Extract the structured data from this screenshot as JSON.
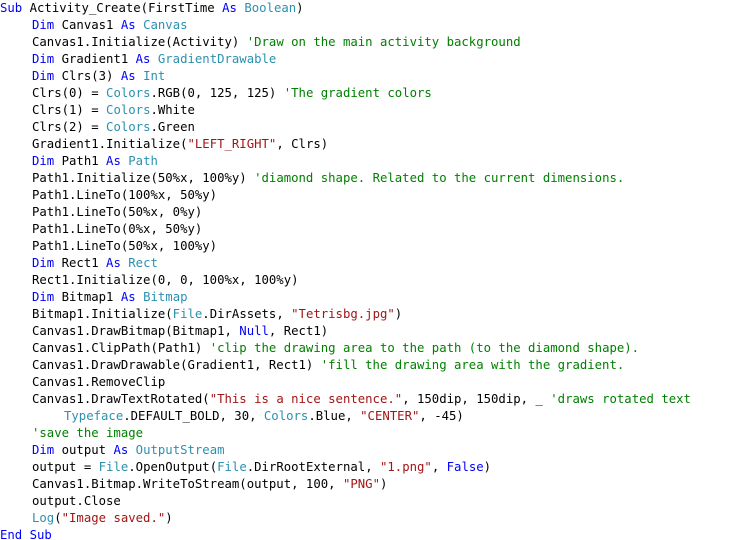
{
  "colors": {
    "keyword": "#0000ff",
    "type": "#2b91af",
    "string": "#a31515",
    "comment": "#008000",
    "plain": "#000000"
  },
  "code_lines": [
    {
      "indent": 0,
      "tokens": [
        [
          "kw",
          "Sub"
        ],
        [
          "pl",
          " Activity_Create(FirstTime "
        ],
        [
          "kw",
          "As"
        ],
        [
          "pl",
          " "
        ],
        [
          "ty",
          "Boolean"
        ],
        [
          "pl",
          ")"
        ]
      ]
    },
    {
      "indent": 1,
      "tokens": [
        [
          "kw",
          "Dim"
        ],
        [
          "pl",
          " Canvas1 "
        ],
        [
          "kw",
          "As"
        ],
        [
          "pl",
          " "
        ],
        [
          "ty",
          "Canvas"
        ]
      ]
    },
    {
      "indent": 1,
      "tokens": [
        [
          "pl",
          "Canvas1.Initialize(Activity) "
        ],
        [
          "cm",
          "'Draw on the main activity background"
        ]
      ]
    },
    {
      "indent": 1,
      "tokens": [
        [
          "kw",
          "Dim"
        ],
        [
          "pl",
          " Gradient1 "
        ],
        [
          "kw",
          "As"
        ],
        [
          "pl",
          " "
        ],
        [
          "ty",
          "GradientDrawable"
        ]
      ]
    },
    {
      "indent": 1,
      "tokens": [
        [
          "kw",
          "Dim"
        ],
        [
          "pl",
          " Clrs(3) "
        ],
        [
          "kw",
          "As"
        ],
        [
          "pl",
          " "
        ],
        [
          "ty",
          "Int"
        ]
      ]
    },
    {
      "indent": 1,
      "tokens": [
        [
          "pl",
          "Clrs(0) = "
        ],
        [
          "ty",
          "Colors"
        ],
        [
          "pl",
          ".RGB(0, 125, 125) "
        ],
        [
          "cm",
          "'The gradient colors"
        ]
      ]
    },
    {
      "indent": 1,
      "tokens": [
        [
          "pl",
          "Clrs(1) = "
        ],
        [
          "ty",
          "Colors"
        ],
        [
          "pl",
          ".White"
        ]
      ]
    },
    {
      "indent": 1,
      "tokens": [
        [
          "pl",
          "Clrs(2) = "
        ],
        [
          "ty",
          "Colors"
        ],
        [
          "pl",
          ".Green"
        ]
      ]
    },
    {
      "indent": 1,
      "tokens": [
        [
          "pl",
          "Gradient1.Initialize("
        ],
        [
          "st",
          "\"LEFT_RIGHT\""
        ],
        [
          "pl",
          ", Clrs)"
        ]
      ]
    },
    {
      "indent": 1,
      "tokens": [
        [
          "kw",
          "Dim"
        ],
        [
          "pl",
          " Path1 "
        ],
        [
          "kw",
          "As"
        ],
        [
          "pl",
          " "
        ],
        [
          "ty",
          "Path"
        ]
      ]
    },
    {
      "indent": 1,
      "tokens": [
        [
          "pl",
          "Path1.Initialize(50%x, 100%y) "
        ],
        [
          "cm",
          "'diamond shape. Related to the current dimensions."
        ]
      ]
    },
    {
      "indent": 1,
      "tokens": [
        [
          "pl",
          "Path1.LineTo(100%x, 50%y)"
        ]
      ]
    },
    {
      "indent": 1,
      "tokens": [
        [
          "pl",
          "Path1.LineTo(50%x, 0%y)"
        ]
      ]
    },
    {
      "indent": 1,
      "tokens": [
        [
          "pl",
          "Path1.LineTo(0%x, 50%y)"
        ]
      ]
    },
    {
      "indent": 1,
      "tokens": [
        [
          "pl",
          "Path1.LineTo(50%x, 100%y)"
        ]
      ]
    },
    {
      "indent": 1,
      "tokens": [
        [
          "kw",
          "Dim"
        ],
        [
          "pl",
          " Rect1 "
        ],
        [
          "kw",
          "As"
        ],
        [
          "pl",
          " "
        ],
        [
          "ty",
          "Rect"
        ]
      ]
    },
    {
      "indent": 1,
      "tokens": [
        [
          "pl",
          "Rect1.Initialize(0, 0, 100%x, 100%y)"
        ]
      ]
    },
    {
      "indent": 1,
      "tokens": [
        [
          "kw",
          "Dim"
        ],
        [
          "pl",
          " Bitmap1 "
        ],
        [
          "kw",
          "As"
        ],
        [
          "pl",
          " "
        ],
        [
          "ty",
          "Bitmap"
        ]
      ]
    },
    {
      "indent": 1,
      "tokens": [
        [
          "pl",
          "Bitmap1.Initialize("
        ],
        [
          "ty",
          "File"
        ],
        [
          "pl",
          ".DirAssets, "
        ],
        [
          "st",
          "\"Tetrisbg.jpg\""
        ],
        [
          "pl",
          ")"
        ]
      ]
    },
    {
      "indent": 1,
      "tokens": [
        [
          "pl",
          "Canvas1.DrawBitmap(Bitmap1, "
        ],
        [
          "kw",
          "Null"
        ],
        [
          "pl",
          ", Rect1)"
        ]
      ]
    },
    {
      "indent": 1,
      "tokens": [
        [
          "pl",
          "Canvas1.ClipPath(Path1) "
        ],
        [
          "cm",
          "'clip the drawing area to the path (to the diamond shape)."
        ]
      ]
    },
    {
      "indent": 1,
      "tokens": [
        [
          "pl",
          "Canvas1.DrawDrawable(Gradient1, Rect1) "
        ],
        [
          "cm",
          "'fill the drawing area with the gradient."
        ]
      ]
    },
    {
      "indent": 1,
      "tokens": [
        [
          "pl",
          "Canvas1.RemoveClip"
        ]
      ]
    },
    {
      "indent": 1,
      "tokens": [
        [
          "pl",
          "Canvas1.DrawTextRotated("
        ],
        [
          "st",
          "\"This is a nice sentence.\""
        ],
        [
          "pl",
          ", 150dip, 150dip, _ "
        ],
        [
          "cm",
          "'draws rotated text"
        ]
      ]
    },
    {
      "indent": 2,
      "tokens": [
        [
          "ty",
          "Typeface"
        ],
        [
          "pl",
          ".DEFAULT_BOLD, 30, "
        ],
        [
          "ty",
          "Colors"
        ],
        [
          "pl",
          ".Blue, "
        ],
        [
          "st",
          "\"CENTER\""
        ],
        [
          "pl",
          ", -45)"
        ]
      ]
    },
    {
      "indent": 1,
      "tokens": [
        [
          "cm",
          "'save the image"
        ]
      ]
    },
    {
      "indent": 1,
      "tokens": [
        [
          "kw",
          "Dim"
        ],
        [
          "pl",
          " output "
        ],
        [
          "kw",
          "As"
        ],
        [
          "pl",
          " "
        ],
        [
          "ty",
          "OutputStream"
        ]
      ]
    },
    {
      "indent": 1,
      "tokens": [
        [
          "pl",
          "output = "
        ],
        [
          "ty",
          "File"
        ],
        [
          "pl",
          ".OpenOutput("
        ],
        [
          "ty",
          "File"
        ],
        [
          "pl",
          ".DirRootExternal, "
        ],
        [
          "st",
          "\"1.png\""
        ],
        [
          "pl",
          ", "
        ],
        [
          "kw",
          "False"
        ],
        [
          "pl",
          ")"
        ]
      ]
    },
    {
      "indent": 1,
      "tokens": [
        [
          "pl",
          "Canvas1.Bitmap.WriteToStream(output, 100, "
        ],
        [
          "st",
          "\"PNG\""
        ],
        [
          "pl",
          ")"
        ]
      ]
    },
    {
      "indent": 1,
      "tokens": [
        [
          "pl",
          "output.Close"
        ]
      ]
    },
    {
      "indent": 1,
      "tokens": [
        [
          "ty",
          "Log"
        ],
        [
          "pl",
          "("
        ],
        [
          "st",
          "\"Image saved.\""
        ],
        [
          "pl",
          ")"
        ]
      ]
    },
    {
      "indent": 0,
      "tokens": [
        [
          "kw",
          "End"
        ],
        [
          "pl",
          " "
        ],
        [
          "kw",
          "Sub"
        ]
      ]
    }
  ]
}
